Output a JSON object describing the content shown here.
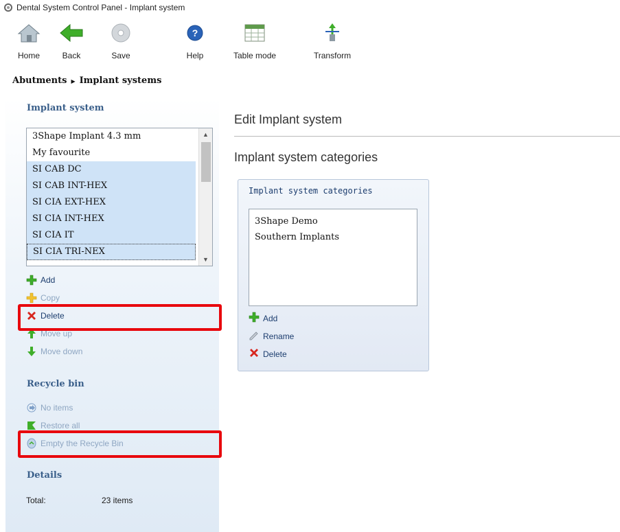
{
  "window": {
    "title": "Dental System Control Panel - Implant system"
  },
  "toolbar": {
    "home": {
      "label": "Home",
      "icon": "home-icon"
    },
    "back": {
      "label": "Back",
      "icon": "back-arrow-icon"
    },
    "save": {
      "label": "Save",
      "icon": "save-disc-icon"
    },
    "help": {
      "label": "Help",
      "icon": "help-icon"
    },
    "table_mode": {
      "label": "Table mode",
      "icon": "table-icon"
    },
    "transform": {
      "label": "Transform",
      "icon": "transform-icon"
    }
  },
  "breadcrumb": {
    "parent": "Abutments",
    "current": "Implant systems"
  },
  "sidebar": {
    "implant_system_heading": "Implant system",
    "implant_list": [
      {
        "label": "3Shape Implant 4.3 mm",
        "selected": false
      },
      {
        "label": "My favourite",
        "selected": false
      },
      {
        "label": "SI CAB DC",
        "selected": true
      },
      {
        "label": "SI CAB INT-HEX",
        "selected": true
      },
      {
        "label": "SI CIA EXT-HEX",
        "selected": true
      },
      {
        "label": "SI CIA INT-HEX",
        "selected": true
      },
      {
        "label": "SI CIA IT",
        "selected": true
      },
      {
        "label": "SI CIA TRI-NEX",
        "selected": true,
        "focused": true
      }
    ],
    "actions": {
      "add": "Add",
      "copy": "Copy",
      "delete": "Delete",
      "move_up": "Move up",
      "move_down": "Move down"
    },
    "recycle_bin_heading": "Recycle bin",
    "recycle": {
      "no_items": "No items",
      "restore_all": "Restore all",
      "empty_bin": "Empty the Recycle Bin"
    },
    "details_heading": "Details",
    "details": {
      "total_label": "Total:",
      "total_value": "23 items"
    }
  },
  "main": {
    "edit_title": "Edit Implant system",
    "categories_title": "Implant system categories",
    "panel": {
      "title": "Implant system categories",
      "items": [
        "3Shape Demo",
        "Southern Implants"
      ],
      "add": "Add",
      "rename": "Rename",
      "delete": "Delete"
    }
  },
  "colors": {
    "highlight": "#e8070d",
    "heading_blue": "#3a5f8a",
    "link_blue": "#1c3d6e",
    "selection": "#cfe3f7"
  }
}
